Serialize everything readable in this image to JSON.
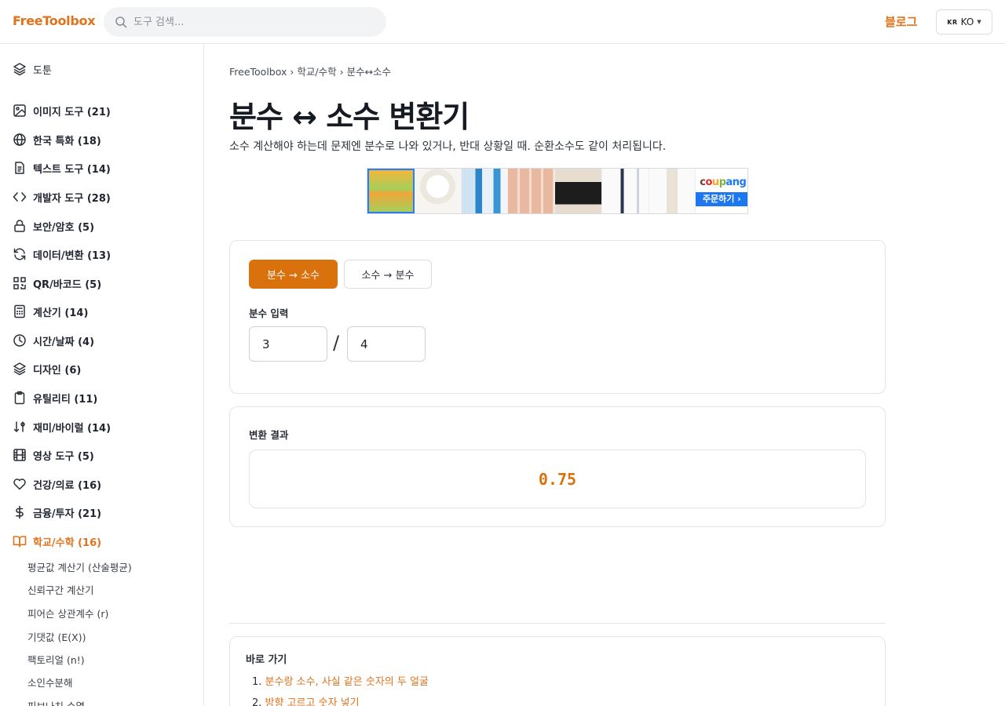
{
  "header": {
    "logo": "FreeToolbox",
    "search_placeholder": "도구 검색...",
    "blog_label": "블로그",
    "lang_flag": "KR",
    "lang_label": "KO"
  },
  "sidebar": {
    "items": [
      {
        "label": "도툰",
        "icon": "layers-icon"
      },
      {
        "label": "이미지 도구 (21)",
        "icon": "image-icon"
      },
      {
        "label": "한국 특화 (18)",
        "icon": "globe-icon"
      },
      {
        "label": "텍스트 도구 (14)",
        "icon": "document-icon"
      },
      {
        "label": "개발자 도구 (28)",
        "icon": "code-icon"
      },
      {
        "label": "보안/암호 (5)",
        "icon": "lock-icon"
      },
      {
        "label": "데이터/변환 (13)",
        "icon": "refresh-icon"
      },
      {
        "label": "QR/바코드 (5)",
        "icon": "qr-icon"
      },
      {
        "label": "계산기 (14)",
        "icon": "calculator-icon"
      },
      {
        "label": "시간/날짜 (4)",
        "icon": "clock-icon"
      },
      {
        "label": "디자인 (6)",
        "icon": "layers-icon"
      },
      {
        "label": "유틸리티 (11)",
        "icon": "clipboard-icon"
      },
      {
        "label": "재미/바이럴 (14)",
        "icon": "sort-icon"
      },
      {
        "label": "영상 도구 (5)",
        "icon": "film-icon"
      },
      {
        "label": "건강/의료 (16)",
        "icon": "heart-icon"
      },
      {
        "label": "금융/투자 (21)",
        "icon": "dollar-icon"
      },
      {
        "label": "학교/수학 (16)",
        "icon": "book-icon"
      }
    ],
    "subitems": [
      "평균값 계산기 (산술평균)",
      "신뢰구간 계산기",
      "피어슨 상관계수 (r)",
      "기댓값 (E(X))",
      "팩토리얼 (n!)",
      "소인수분해",
      "피보나치 수열"
    ]
  },
  "breadcrumb": {
    "home": "FreeToolbox",
    "sep1": "›",
    "category": "학교/수학",
    "sep2": "›",
    "current": "분수↔소수"
  },
  "page": {
    "title": "분수 ↔ 소수 변환기",
    "description": "소수 계산해야 하는데 문제엔 분수로 나와 있거나, 반대 상황일 때. 순환소수도 같이 처리됩니다."
  },
  "ad": {
    "brand": "coupang",
    "cta": "주문하기 ›",
    "brand_colors": [
      "#e3242b",
      "#f5a623",
      "#7cb342",
      "#1d78f0"
    ]
  },
  "converter": {
    "tab_active": "분수 → 소수",
    "tab_inactive": "소수 → 분수",
    "input_label": "분수 입력",
    "numerator": "3",
    "slash": "/",
    "denominator": "4"
  },
  "result": {
    "label": "변환 결과",
    "value": "0.75"
  },
  "toc": {
    "title": "바로 가기",
    "items": [
      {
        "num": "1.",
        "label": "분수랑 소수, 사실 같은 숫자의 두 얼굴"
      },
      {
        "num": "2.",
        "label": "방향 고르고 숫자 넣기"
      }
    ]
  },
  "colors": {
    "accent": "#e0731d",
    "button": "#d9720c"
  }
}
